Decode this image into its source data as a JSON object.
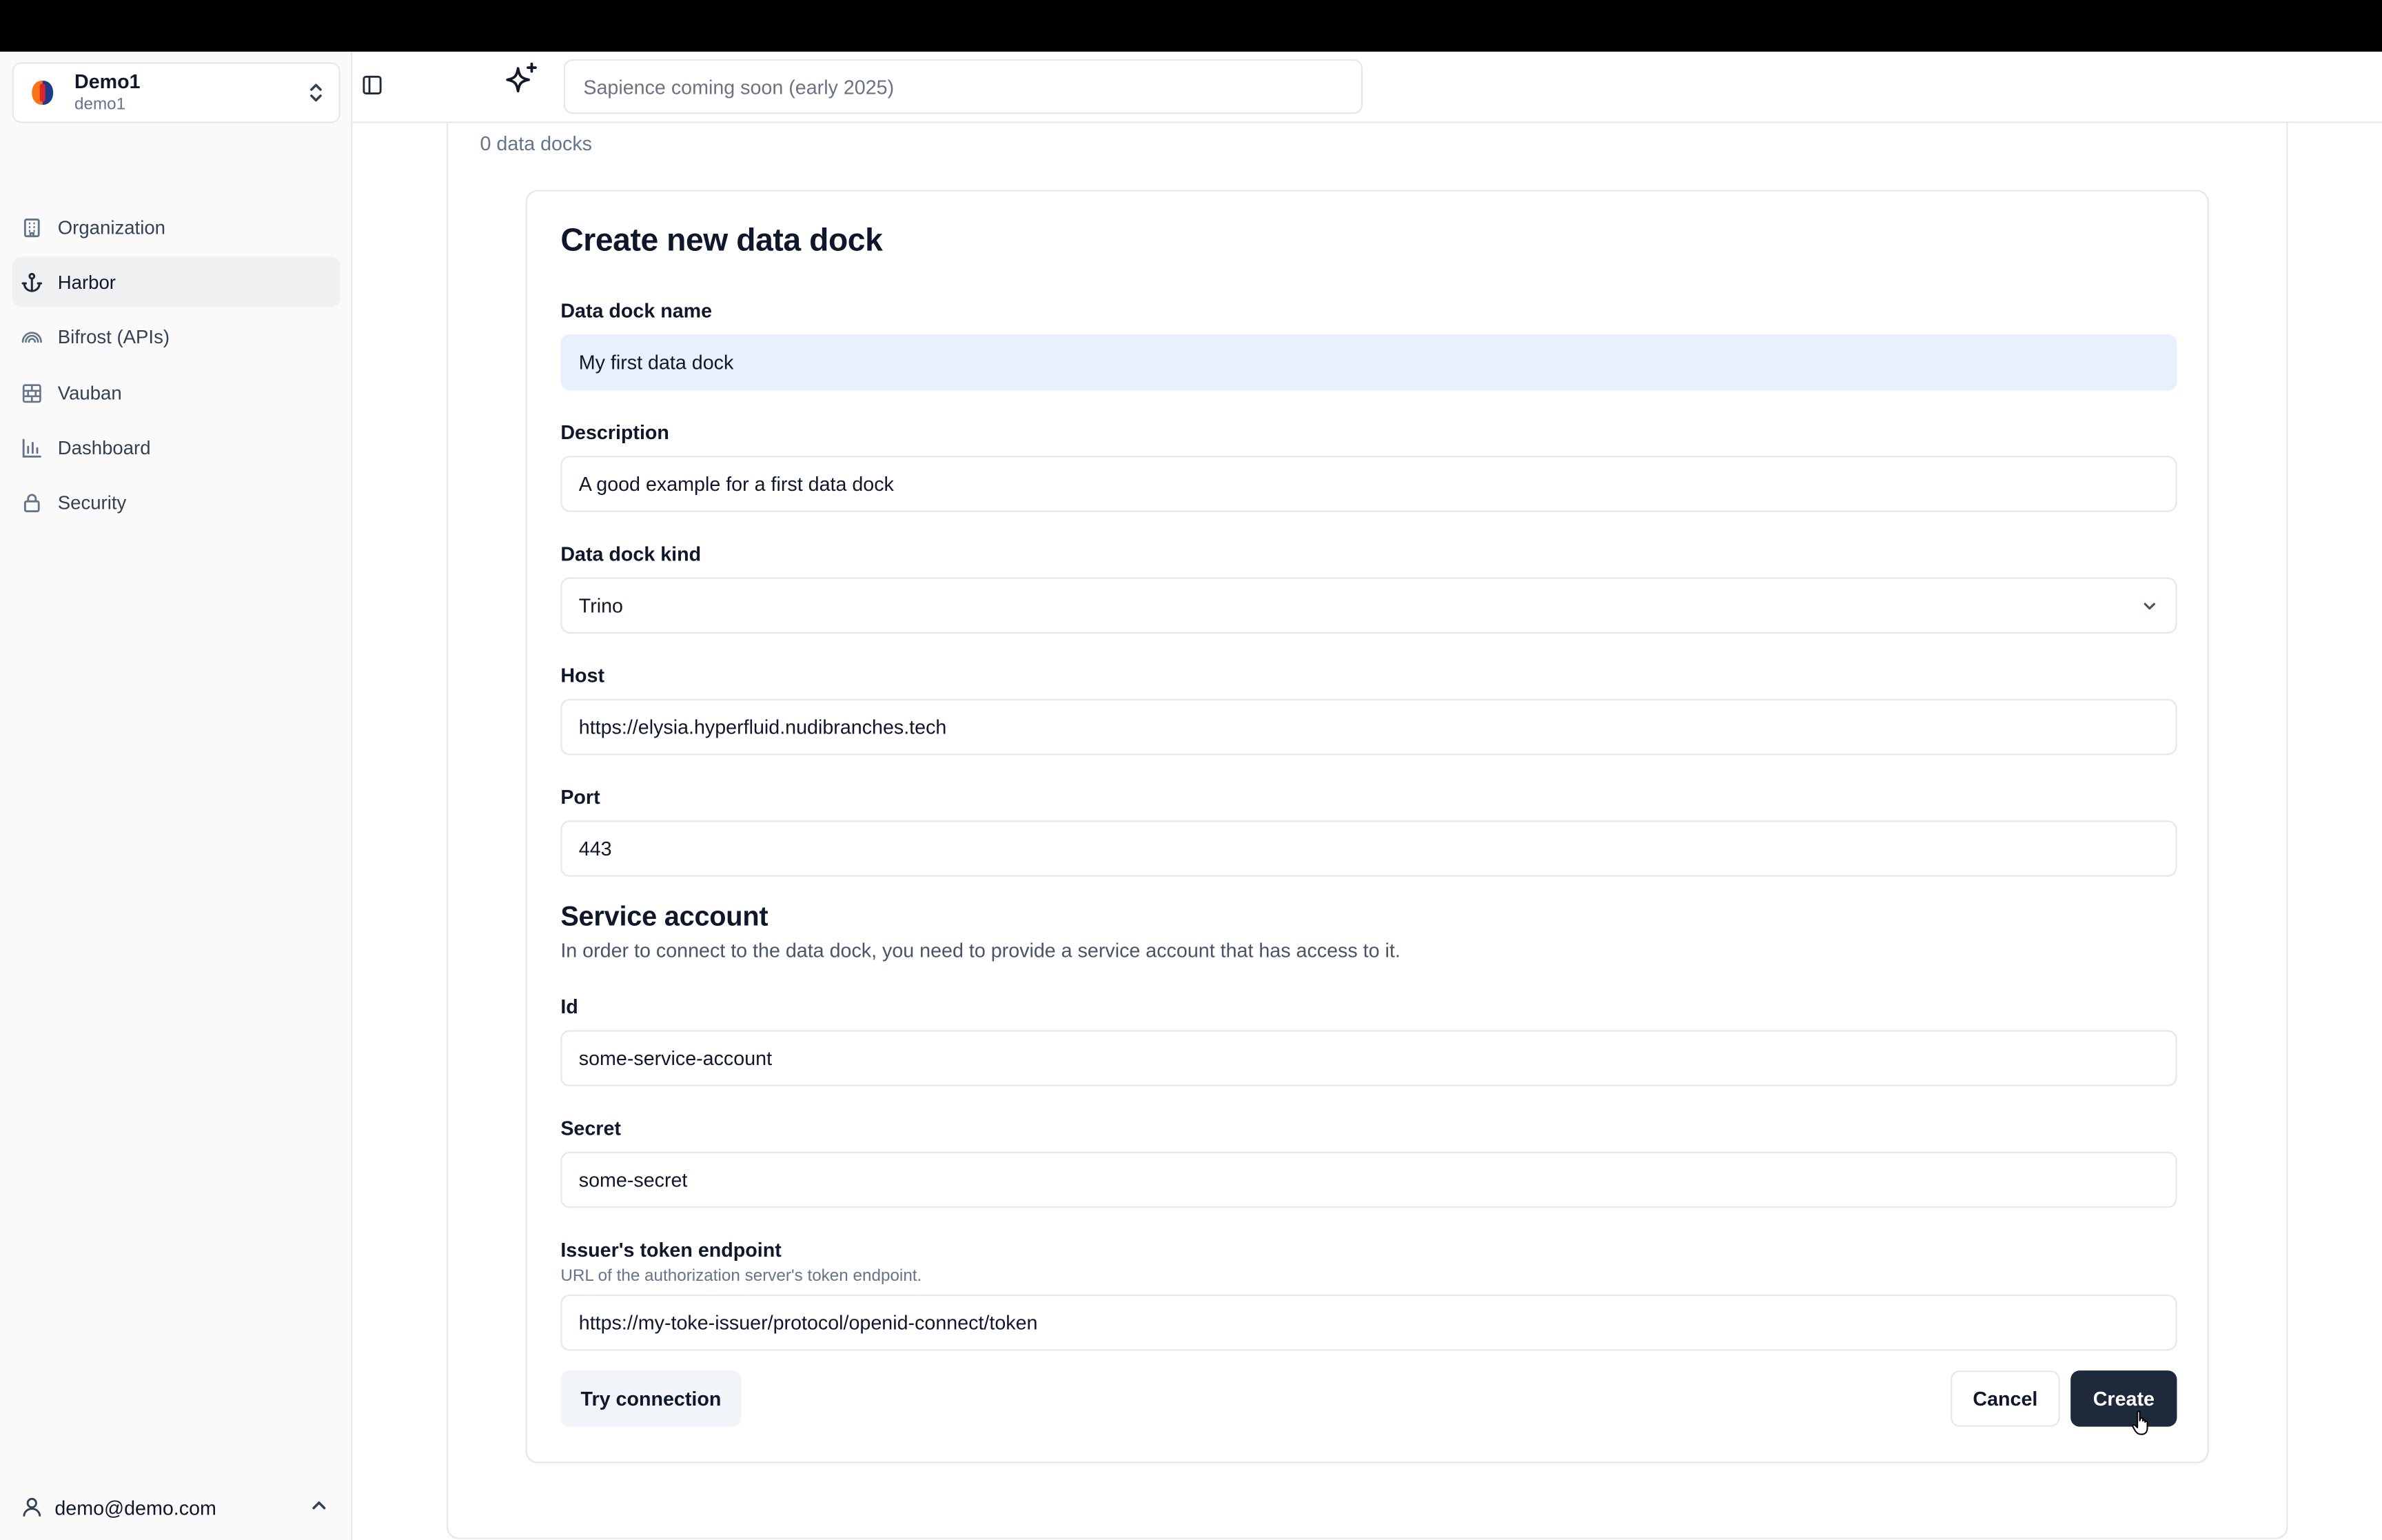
{
  "org": {
    "name": "Demo1",
    "slug": "demo1"
  },
  "sidebar": {
    "items": [
      {
        "label": "Organization",
        "icon": "building-icon",
        "active": false
      },
      {
        "label": "Harbor",
        "icon": "anchor-icon",
        "active": true
      },
      {
        "label": "Bifrost (APIs)",
        "icon": "rainbow-icon",
        "active": false
      },
      {
        "label": "Vauban",
        "icon": "brick-wall-icon",
        "active": false
      },
      {
        "label": "Dashboard",
        "icon": "bar-chart-icon",
        "active": false
      },
      {
        "label": "Security",
        "icon": "lock-icon",
        "active": false
      }
    ],
    "user_email": "demo@demo.com"
  },
  "header": {
    "sapience_placeholder": "Sapience coming soon (early 2025)"
  },
  "main": {
    "docks_count_text": "0 data docks"
  },
  "form": {
    "title": "Create new data dock",
    "name_label": "Data dock name",
    "name_value": "My first data dock",
    "description_label": "Description",
    "description_value": "A good example for a first data dock",
    "kind_label": "Data dock kind",
    "kind_value": "Trino",
    "host_label": "Host",
    "host_value": "https://elysia.hyperfluid.nudibranches.tech",
    "port_label": "Port",
    "port_value": "443",
    "service_account_title": "Service account",
    "service_account_desc": "In order to connect to the data dock, you need to provide a service account that has access to it.",
    "id_label": "Id",
    "id_value": "some-service-account",
    "secret_label": "Secret",
    "secret_value": "some-secret",
    "token_endpoint_label": "Issuer's token endpoint",
    "token_endpoint_help": "URL of the authorization server's token endpoint.",
    "token_endpoint_value": "https://my-toke-issuer/protocol/openid-connect/token",
    "try_connection_label": "Try connection",
    "cancel_label": "Cancel",
    "create_label": "Create"
  },
  "colors": {
    "primary_button": "#1e293b",
    "autofill_bg": "#e8f0fe",
    "active_nav_bg": "#eff0f2",
    "topbar": "#000000"
  }
}
